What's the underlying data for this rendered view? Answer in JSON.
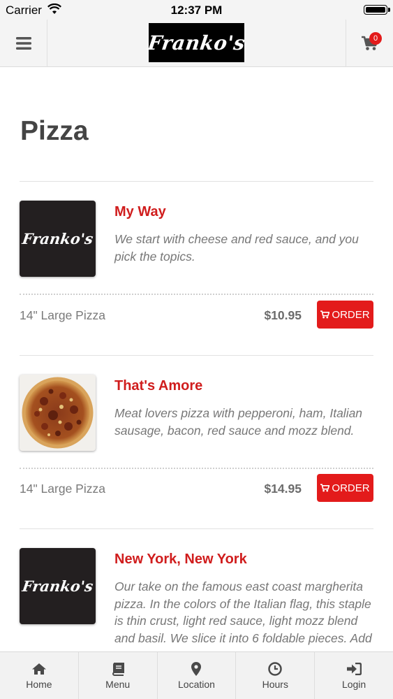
{
  "status_bar": {
    "carrier": "Carrier",
    "time": "12:37 PM"
  },
  "header": {
    "logo_text": "Franko's",
    "cart_count": "0"
  },
  "page": {
    "title": "Pizza"
  },
  "items": [
    {
      "name": "My Way",
      "description": "We start with cheese and red sauce, and you pick the topics.",
      "thumbnail": "logo",
      "thumbnail_text": "Franko's",
      "size": "14\" Large Pizza",
      "price": "$10.95",
      "order_label": "ORDER"
    },
    {
      "name": "That's Amore",
      "description": "Meat lovers pizza with pepperoni, ham, Italian sausage, bacon, red sauce and mozz blend.",
      "thumbnail": "pizza-photo",
      "size": "14\" Large Pizza",
      "price": "$14.95",
      "order_label": "ORDER"
    },
    {
      "name": "New York, New York",
      "description": "Our take on the famous east coast margherita pizza. In the colors of the Italian flag, this staple is thin crust, light red sauce, light mozz blend and basil. We slice it into 6 foldable pieces. Add",
      "thumbnail": "logo",
      "thumbnail_text": "Franko's"
    }
  ],
  "tab_bar": [
    {
      "label": "Home",
      "icon": "home-icon"
    },
    {
      "label": "Menu",
      "icon": "book-icon"
    },
    {
      "label": "Location",
      "icon": "map-pin-icon"
    },
    {
      "label": "Hours",
      "icon": "clock-icon"
    },
    {
      "label": "Login",
      "icon": "login-icon"
    }
  ],
  "colors": {
    "accent_red": "#e31b1b",
    "item_name_red": "#d01d1d",
    "header_bg": "#f4f4f4",
    "logo_bg": "#000000"
  }
}
